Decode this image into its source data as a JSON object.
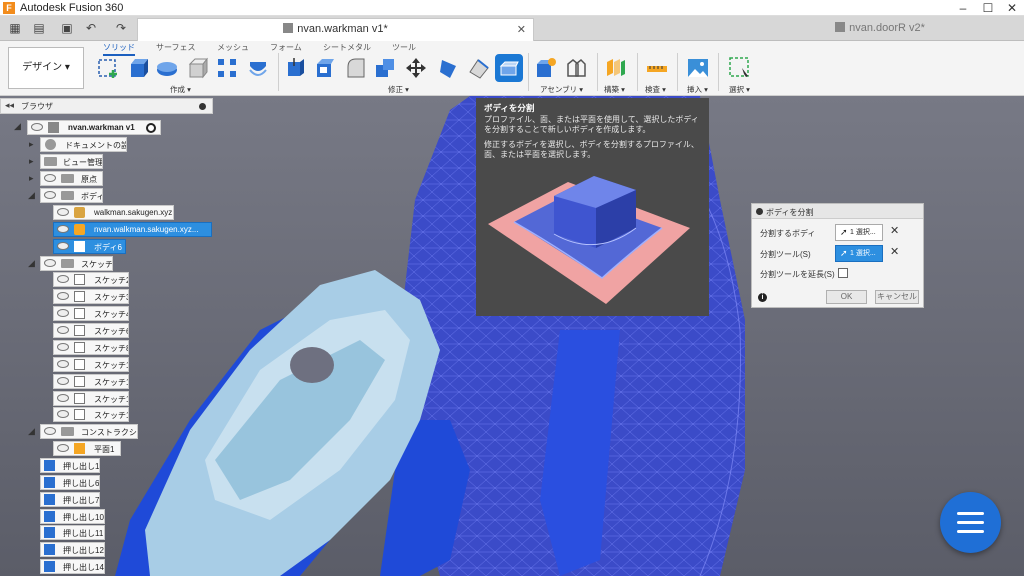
{
  "window": {
    "title": "Autodesk Fusion 360",
    "logo_letter": "F"
  },
  "tabs": [
    {
      "label": "nvan.warkman v1*",
      "active": true
    },
    {
      "label": "nvan.doorR v2*",
      "active": false
    }
  ],
  "toolbar": {
    "workspace": "デザイン ▾",
    "ribbon_tabs": [
      "ソリッド",
      "サーフェス",
      "メッシュ",
      "フォーム",
      "シートメタル",
      "ツール"
    ],
    "groups": [
      "作成 ▾",
      "修正 ▾",
      "アセンブリ ▾",
      "構築 ▾",
      "検査 ▾",
      "挿入 ▾",
      "選択 ▾"
    ]
  },
  "browser": {
    "title": "ブラウザ",
    "root": "nvan.warkman v1",
    "items": [
      "ドキュメントの設定",
      "ビュー管理",
      "原点",
      "ボディ",
      "walkman.sakugen.xyz",
      "nvan.walkman.sakugen.xyz...",
      "ボディ6",
      "スケッチ",
      "スケッチ2",
      "スケッチ3",
      "スケッチ4",
      "スケッチ6",
      "スケッチ8",
      "スケッチ10",
      "スケッチ11",
      "スケッチ12",
      "スケッチ13",
      "コンストラクション",
      "平面1",
      "押し出し1",
      "押し出し6",
      "押し出し7",
      "押し出し10",
      "押し出し11",
      "押し出し12",
      "押し出し14"
    ]
  },
  "tooltip": {
    "title": "ボディを分割",
    "description": "プロファイル、面、または平面を使用して、選択したボディを分割することで新しいボディを作成します。",
    "hint": "修正するボディを選択し、ボディを分割するプロファイル、面、または平面を選択します。"
  },
  "dialog": {
    "title": "ボディを分割",
    "row1_label": "分割するボディ",
    "row1_value": "1 選択...",
    "row2_label": "分割ツール(S)",
    "row2_value": "1 選択...",
    "row3_label": "分割ツールを延長(S)",
    "ok": "OK",
    "cancel": "キャンセル"
  },
  "colors": {
    "accent": "#1b78d4",
    "mesh": "#3b4bc8",
    "part": "#a8cde6",
    "fab": "#1f6fd6"
  }
}
